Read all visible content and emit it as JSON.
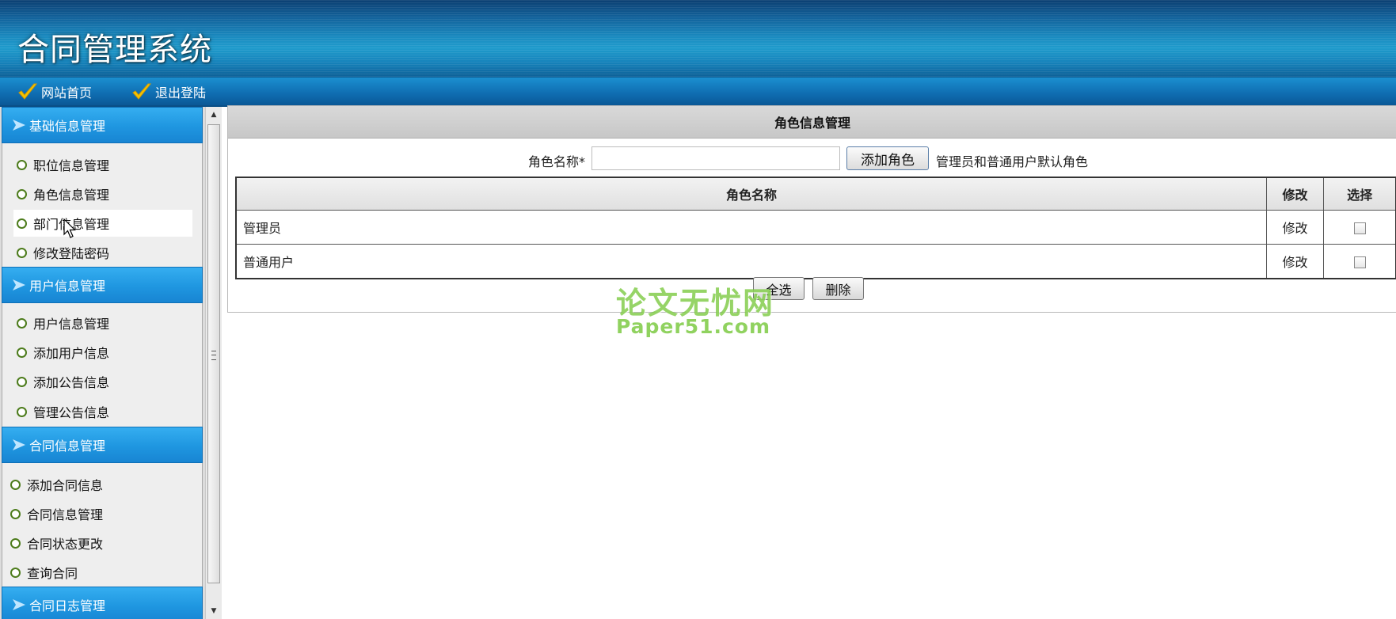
{
  "app": {
    "title": "合同管理系统"
  },
  "topnav": {
    "items": [
      {
        "label": "网站首页"
      },
      {
        "label": "退出登陆"
      }
    ]
  },
  "sidebar": {
    "groups": [
      {
        "title": "基础信息管理",
        "items": [
          "职位信息管理",
          "角色信息管理",
          "部门信息管理",
          "修改登陆密码"
        ]
      },
      {
        "title": "用户信息管理",
        "items": [
          "用户信息管理",
          "添加用户信息",
          "添加公告信息",
          "管理公告信息"
        ]
      },
      {
        "title": "合同信息管理",
        "items": [
          "添加合同信息",
          "合同信息管理",
          "合同状态更改",
          "查询合同"
        ]
      },
      {
        "title": "合同日志管理",
        "items": []
      }
    ],
    "hovered_item": "部门信息管理"
  },
  "main": {
    "panel_title": "角色信息管理",
    "form": {
      "role_name_label": "角色名称*",
      "role_name_value": "",
      "add_button": "添加角色",
      "default_note": "管理员和普通用户默认角色"
    },
    "table": {
      "headers": [
        "角色名称",
        "修改",
        "选择"
      ],
      "rows": [
        {
          "name": "管理员",
          "edit": "修改",
          "checked": false
        },
        {
          "name": "普通用户",
          "edit": "修改",
          "checked": false
        }
      ]
    },
    "select_all_button": "全选",
    "delete_button": "删除"
  },
  "watermark": {
    "cn": "论文无忧网",
    "en": "Paper51.com"
  },
  "colors": {
    "header_blue": "#1a8bc0",
    "sidebar_header_blue": "#1f96e0",
    "watermark_green": "#78c83c"
  }
}
